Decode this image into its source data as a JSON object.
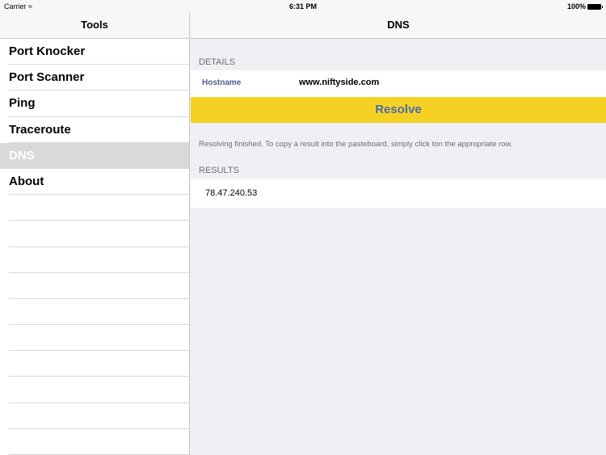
{
  "status": {
    "carrier": "Carrier",
    "time": "6:31 PM",
    "battery": "100%"
  },
  "sidebar": {
    "title": "Tools",
    "items": [
      {
        "label": "Port Knocker"
      },
      {
        "label": "Port Scanner"
      },
      {
        "label": "Ping"
      },
      {
        "label": "Traceroute"
      },
      {
        "label": "DNS",
        "selected": true
      },
      {
        "label": "About"
      }
    ]
  },
  "main": {
    "title": "DNS",
    "details_header": "DETAILS",
    "hostname_label": "Hostname",
    "hostname_value": "www.niftyside.com",
    "resolve_label": "Resolve",
    "message": "Resolving finished. To copy a result into the pasteboard, simply click ton the appropriate row.",
    "results_header": "RESULTS",
    "results": [
      "78.47.240.53"
    ]
  },
  "colors": {
    "accent": "#f5d124",
    "button_text": "#4a6bb0"
  }
}
